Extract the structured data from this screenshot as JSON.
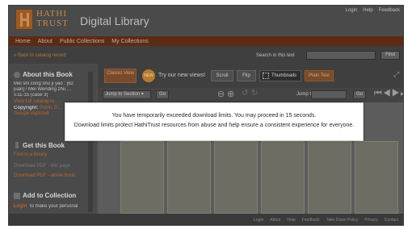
{
  "header": {
    "logo_line1": "HATHI",
    "logo_line2": "TRUST",
    "brand_suffix": "Digital Library",
    "links": [
      "Login",
      "Help",
      "Feedback"
    ]
  },
  "nav": {
    "items": [
      "Home",
      "About",
      "Public Collections",
      "My Collections"
    ]
  },
  "subbar": {
    "back_link": "« Back to catalog record",
    "search_label": "Search in this text",
    "search_value": "",
    "find_label": "Find"
  },
  "sidebar": {
    "about_heading": "About this Book",
    "title_lines": [
      "Mei shi cong shu ji yao : [62",
      "juan] / Mei Wending zhu ...",
      "v.11-15 (case 3)"
    ],
    "catalog_link": "View full catalog re...",
    "copyright_label": "Copyright:",
    "copyright_value": "Public D...",
    "copyright_sub": "Google-digitized",
    "get_heading": "Get this Book",
    "find_library": "Find in a library",
    "download_pdf_page": "Download PDF - this page",
    "download_pdf_whole": "Download PDF - whole book",
    "add_heading": "Add to Collection",
    "login_link": "Login",
    "login_text": "to make your personal"
  },
  "toolbar": {
    "classic_view": "Classic View",
    "new_badge": "NEW",
    "try_views": "Try our new views!",
    "scroll_label": "Scroll",
    "flip_label": "Flip",
    "thumbnail_label": "Thumbnails",
    "plain_text_label": "Plain Text"
  },
  "controls": {
    "jump_section": "Jump to Section",
    "go_label": "Go",
    "jump_label": "Jump to",
    "jump_value": "",
    "go2_label": "Go"
  },
  "dialog": {
    "line1": "You have temporarily exceeded download limits. You may proceed in 15 seconds.",
    "line2": "Download limits protect HathiTrust resources from abuse and help ensure a consistent experience for everyone."
  },
  "footer": {
    "links": [
      "Login",
      "About",
      "Help",
      "Feedback",
      "Take-Down Policy",
      "Privacy",
      "Contact"
    ]
  },
  "colors": {
    "accent": "#b8642e",
    "nav_bg": "#5d2b14",
    "dialog_bg": "#ffffff"
  },
  "icons": [
    "logo-icon",
    "info-icon",
    "download-icon",
    "collection-icon",
    "zoom-in-icon",
    "zoom-out-icon",
    "rotate-left-icon",
    "rotate-right-icon",
    "first-page-icon",
    "prev-page-icon",
    "next-page-icon",
    "last-page-icon",
    "expand-icon"
  ]
}
